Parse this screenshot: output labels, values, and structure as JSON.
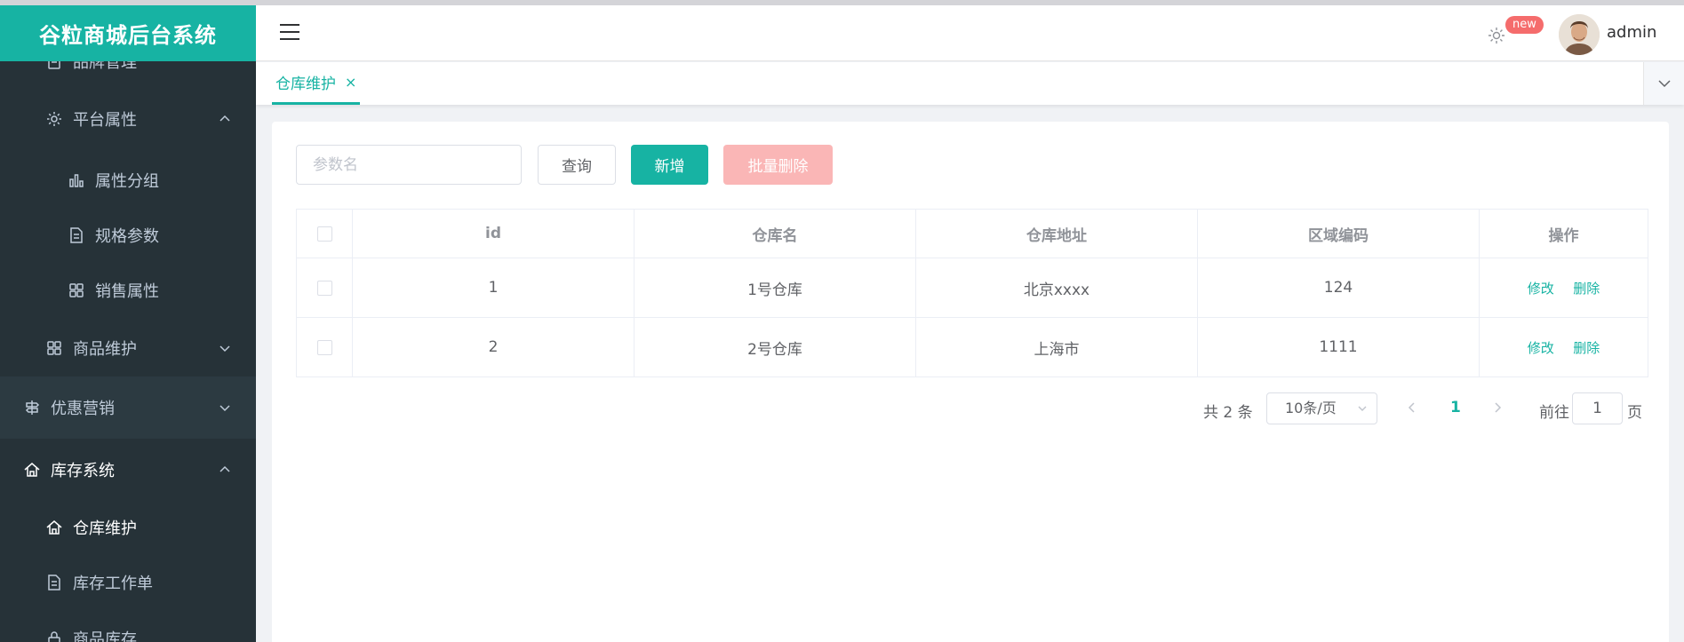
{
  "app": {
    "title": "谷粒商城后台系统"
  },
  "sidebar": {
    "items": [
      {
        "label": "品牌管理",
        "icon": "document-icon"
      },
      {
        "label": "平台属性",
        "icon": "gear-icon",
        "expanded": true
      },
      {
        "label": "属性分组",
        "icon": "bar-chart-icon"
      },
      {
        "label": "规格参数",
        "icon": "document-icon"
      },
      {
        "label": "销售属性",
        "icon": "grid-icon"
      },
      {
        "label": "商品维护",
        "icon": "grid-icon",
        "expanded": false
      },
      {
        "label": "优惠营销",
        "icon": "signpost-icon",
        "expanded": false
      },
      {
        "label": "库存系统",
        "icon": "home-icon",
        "expanded": true
      },
      {
        "label": "仓库维护",
        "icon": "home-icon",
        "active": true
      },
      {
        "label": "库存工作单",
        "icon": "document-icon"
      },
      {
        "label": "商品库存",
        "icon": "lock-icon"
      }
    ]
  },
  "header": {
    "badge": "new",
    "username": "admin"
  },
  "tabs": [
    {
      "label": "仓库维护",
      "close": "×"
    }
  ],
  "toolbar": {
    "search_placeholder": "参数名",
    "query_label": "查询",
    "add_label": "新增",
    "batch_delete_label": "批量删除"
  },
  "table": {
    "headers": [
      "id",
      "仓库名",
      "仓库地址",
      "区域编码",
      "操作"
    ],
    "rows": [
      {
        "id": "1",
        "name": "1号仓库",
        "address": "北京xxxx",
        "area_code": "124"
      },
      {
        "id": "2",
        "name": "2号仓库",
        "address": "上海市",
        "area_code": "1111"
      }
    ],
    "edit_label": "修改",
    "delete_label": "删除"
  },
  "pagination": {
    "total_text": "共 2 条",
    "page_size": "10条/页",
    "current_page": "1",
    "goto_label": "前往",
    "goto_value": "1",
    "page_suffix": "页"
  },
  "colors": {
    "accent": "#17b3a3",
    "sidebar_bg": "#263238",
    "danger_light": "#fab6b6",
    "badge": "#f56c6c"
  }
}
